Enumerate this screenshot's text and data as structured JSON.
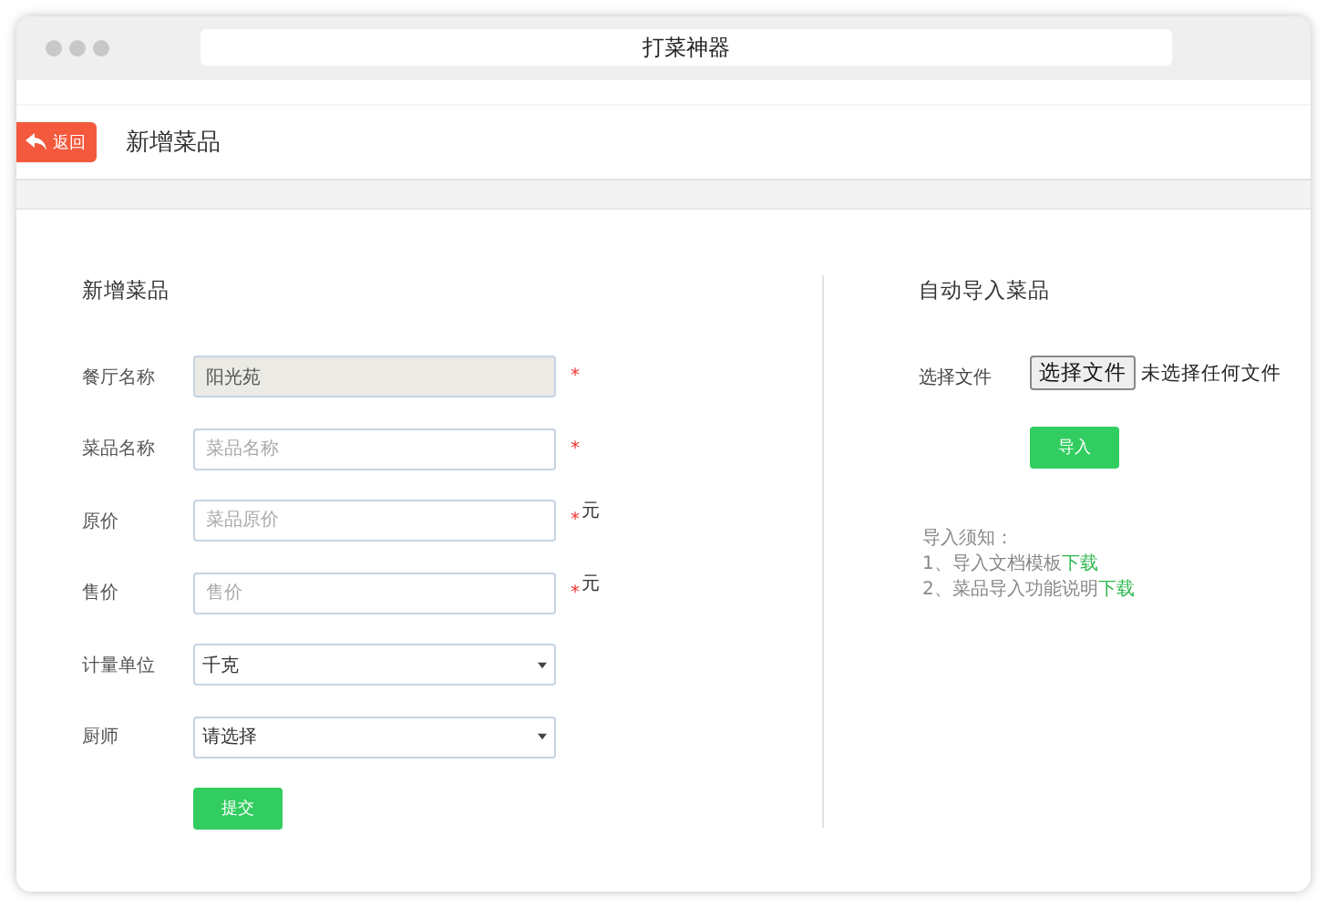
{
  "window": {
    "title": "打菜神器"
  },
  "header": {
    "back_button": "返回",
    "title": "新增菜品"
  },
  "form": {
    "title": "新增菜品",
    "fields": [
      {
        "kind": "readonly",
        "label": "餐厅名称",
        "value": "阳光苑",
        "required_mark": "*"
      },
      {
        "kind": "text",
        "label": "菜品名称",
        "placeholder": "菜品名称",
        "required_mark": "*"
      },
      {
        "kind": "text",
        "label": "原价",
        "placeholder": "菜品原价",
        "required_mark": "*",
        "suffix": "元"
      },
      {
        "kind": "text",
        "label": "售价",
        "placeholder": "售价",
        "required_mark": "*",
        "suffix": "元"
      },
      {
        "kind": "select",
        "label": "计量单位",
        "value": "千克"
      },
      {
        "kind": "select",
        "label": "厨师",
        "value": "请选择"
      }
    ],
    "submit": "提交"
  },
  "import": {
    "title": "自动导入菜品",
    "file_label": "选择文件",
    "file_button": "选择文件",
    "file_status": "未选择任何文件",
    "import_button": "导入",
    "notes_title": "导入须知：",
    "notes": [
      {
        "text": "1、导入文档模板",
        "link": "下载"
      },
      {
        "text": "2、菜品导入功能说明",
        "link": "下载"
      }
    ]
  }
}
